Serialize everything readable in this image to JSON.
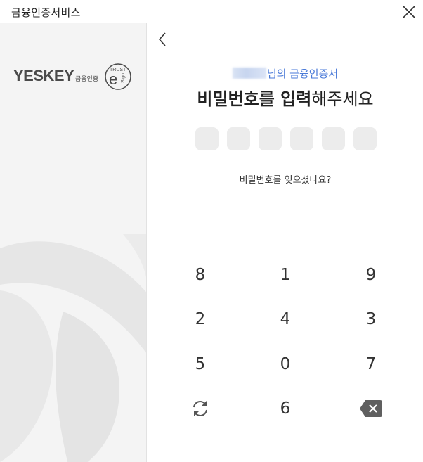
{
  "window": {
    "title": "금융인증서비스"
  },
  "brand": {
    "logo_text": "YESKEY",
    "logo_sub": "금융인증",
    "seal_top": "TRUST",
    "seal_letter": "e",
    "seal_side": "Sign"
  },
  "header": {
    "owner_suffix": "님의 금융인증서",
    "prompt_bold": "비밀번호를 입력",
    "prompt_rest": "해주세요"
  },
  "password": {
    "length": 6,
    "entered": 0
  },
  "forgot_link": "비밀번호를 잊으셨나요?",
  "keypad": {
    "row1": [
      "8",
      "1",
      "9"
    ],
    "row2": [
      "2",
      "4",
      "3"
    ],
    "row3": [
      "5",
      "0",
      "7"
    ],
    "row4_center": "6",
    "shuffle_icon": "refresh-icon",
    "delete_icon": "backspace-icon"
  }
}
